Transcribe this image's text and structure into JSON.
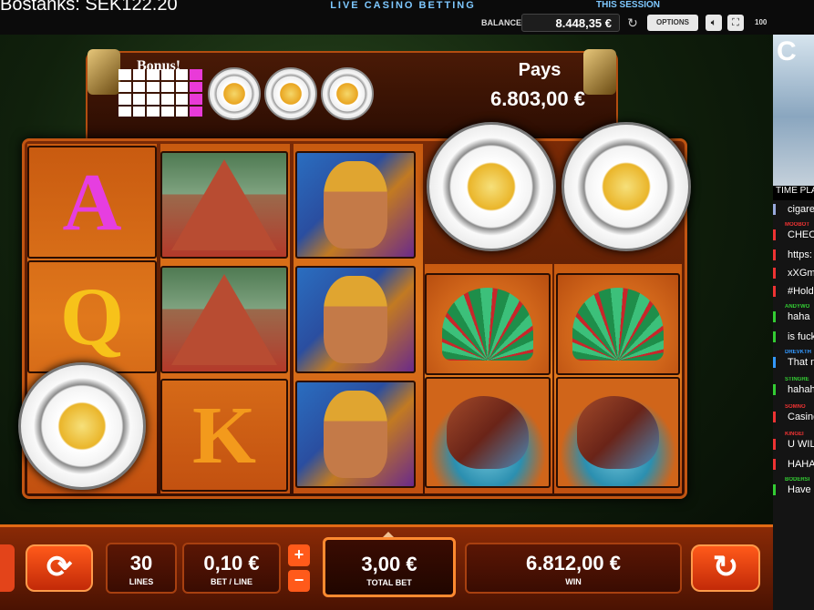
{
  "topbar": {
    "stream_title": "Bostanks: SEK122.20",
    "casino_banner": "LIVE CASINO BETTING",
    "session_label": "THIS SESSION",
    "balance_label": "BALANCE",
    "balance_value": "8.448,35 €",
    "options_label": "OPTIONS",
    "zoom_label": "100"
  },
  "game": {
    "bonus_label": "Bonus!",
    "bonus_cells_on": [
      5,
      11,
      17,
      23
    ],
    "pays_label": "Pays",
    "pays_value": "6.803,00 €",
    "reel_letters": {
      "a": "A",
      "q": "Q",
      "k": "K"
    },
    "letter_colors": {
      "a": "#e63ee0",
      "q": "#f7c21a",
      "k": "#f39a1c"
    }
  },
  "controls": {
    "lines_value": "30",
    "lines_label": "LINES",
    "betline_value": "0,10 €",
    "betline_label": "BET / LINE",
    "totalbet_value": "3,00 €",
    "totalbet_label": "TOTAL BET",
    "win_value": "6.812,00 €",
    "win_label": "WIN",
    "plus": "+",
    "minus": "−"
  },
  "chat": {
    "video_letter": "C",
    "time_label": "TIME PLA",
    "messages": [
      {
        "user": "",
        "text": "cigare",
        "color": "#9ad"
      },
      {
        "user": "MOOBOT",
        "text": "CHECK",
        "color": "#e33"
      },
      {
        "user": "",
        "text": "https:",
        "color": "#e33"
      },
      {
        "user": "",
        "text": "xXGm",
        "color": "#e33"
      },
      {
        "user": "",
        "text": "#Hold",
        "color": "#e33"
      },
      {
        "user": "ANDYWO",
        "text": "haha",
        "color": "#3c3"
      },
      {
        "user": "",
        "text": "is fuck",
        "color": "#3c3"
      },
      {
        "user": "DREVKTH",
        "text": "That n",
        "color": "#39f"
      },
      {
        "user": "STINGRE",
        "text": "hahah",
        "color": "#3c3"
      },
      {
        "user": "SOMNO",
        "text": "Casino",
        "color": "#e33"
      },
      {
        "user": "KINGEI",
        "text": "U WIL",
        "color": "#e33"
      },
      {
        "user": "",
        "text": "HAHA",
        "color": "#e33"
      },
      {
        "user": "BODERSI",
        "text": "Have",
        "color": "#3c3"
      }
    ]
  }
}
